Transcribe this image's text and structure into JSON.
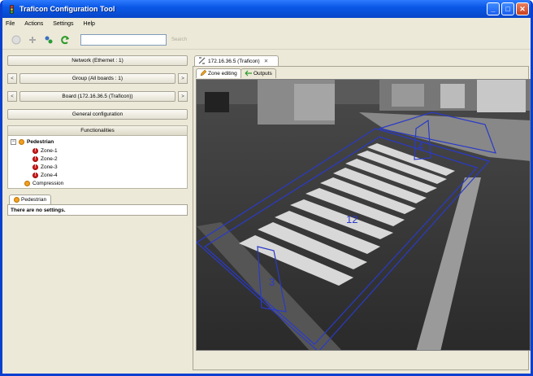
{
  "window": {
    "title": "Traficon Configuration Tool",
    "buttons": [
      "_",
      "□",
      "✕"
    ]
  },
  "menu": [
    "File",
    "Actions",
    "Settings",
    "Help"
  ],
  "toolbar": {
    "search_button": "Search"
  },
  "left": {
    "network": "Network (Ethernet : 1)",
    "group": "Group (All boards : 1)",
    "board": "Board (172.16.36.5 (Traficon))",
    "general_configuration": "General configuration",
    "functionalities": "Functionalities",
    "tree": {
      "root": "Pedestrian",
      "root_expander": "−",
      "zones": [
        "Zone-1",
        "Zone-2",
        "Zone-3",
        "Zone-4"
      ],
      "compression": "Compression"
    },
    "settings_tab": "Pedestrian",
    "settings_message": "There are no settings."
  },
  "right": {
    "doc_tab": "172.16.36.5 (Traficon)",
    "doc_tab_close": "✕",
    "sub_tabs": [
      "Zone editing",
      "Outputs"
    ],
    "zone_labels": [
      "12",
      "3",
      "4"
    ]
  },
  "colors": {
    "zone_stroke": "#2a3ac8",
    "xp_title": "#0a58e6"
  }
}
